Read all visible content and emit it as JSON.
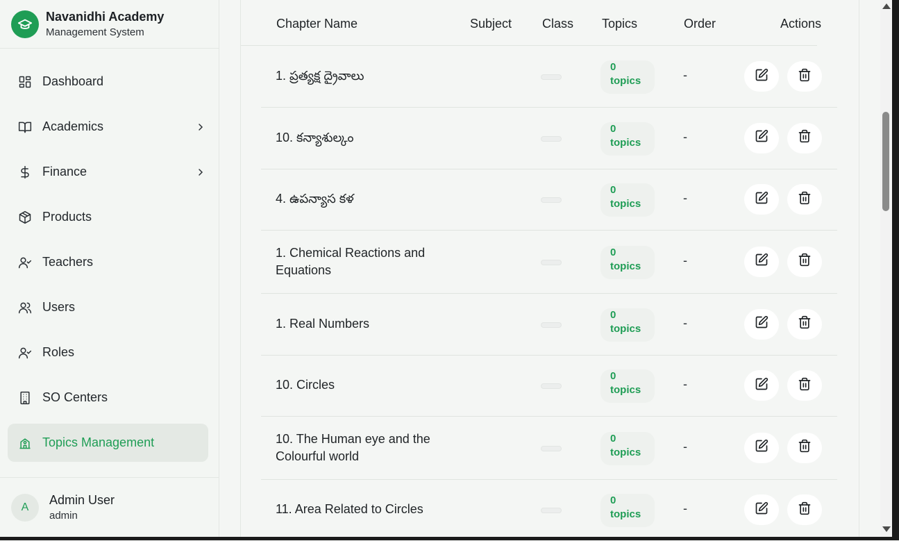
{
  "brand": {
    "name": "Navanidhi Academy",
    "subtitle": "Management System"
  },
  "nav": [
    {
      "label": "Dashboard",
      "icon": "dashboard-icon"
    },
    {
      "label": "Academics",
      "icon": "book-icon",
      "expandable": true
    },
    {
      "label": "Finance",
      "icon": "dollar-icon",
      "expandable": true
    },
    {
      "label": "Products",
      "icon": "package-icon"
    },
    {
      "label": "Teachers",
      "icon": "user-check-icon"
    },
    {
      "label": "Users",
      "icon": "users-icon"
    },
    {
      "label": "Roles",
      "icon": "user-check-icon"
    },
    {
      "label": "SO Centers",
      "icon": "building-icon"
    },
    {
      "label": "Topics Management",
      "icon": "school-icon",
      "active": true
    }
  ],
  "user": {
    "initial": "A",
    "name": "Admin User",
    "role": "admin"
  },
  "table": {
    "headers": {
      "chapter": "Chapter Name",
      "subject": "Subject",
      "class": "Class",
      "topics": "Topics",
      "order": "Order",
      "actions": "Actions"
    },
    "rows": [
      {
        "name": "1. ప్రత్యక్ష ద్రైవాలు",
        "topics_count": "0",
        "topics_word": "topics",
        "order": "-"
      },
      {
        "name": "10. కన్యాశుల్కం",
        "topics_count": "0",
        "topics_word": "topics",
        "order": "-"
      },
      {
        "name": "4. ఉపన్యాస కళ",
        "topics_count": "0",
        "topics_word": "topics",
        "order": "-"
      },
      {
        "name": "1. Chemical Reactions and Equations",
        "topics_count": "0",
        "topics_word": "topics",
        "order": "-"
      },
      {
        "name": "1. Real Numbers",
        "topics_count": "0",
        "topics_word": "topics",
        "order": "-"
      },
      {
        "name": "10. Circles",
        "topics_count": "0",
        "topics_word": "topics",
        "order": "-"
      },
      {
        "name": "10. The Human eye and the Colourful world",
        "topics_count": "0",
        "topics_word": "topics",
        "order": "-"
      },
      {
        "name": "11. Area Related to Circles",
        "topics_count": "0",
        "topics_word": "topics",
        "order": "-"
      }
    ]
  },
  "colors": {
    "accent": "#1f9d55",
    "active_bg": "#e4e9e4"
  }
}
